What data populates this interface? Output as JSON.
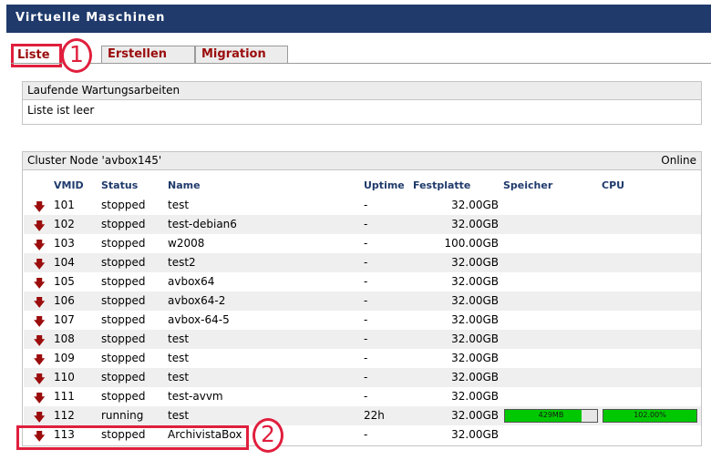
{
  "window_title": "Virtuelle Maschinen",
  "tabs": [
    {
      "label": "Liste",
      "active": true
    },
    {
      "label": "Erstellen",
      "active": false
    },
    {
      "label": "Migration",
      "active": false
    }
  ],
  "annotations": {
    "marker1": "1",
    "marker2": "2"
  },
  "maintenance": {
    "title": "Laufende Wartungsarbeiten",
    "body": "Liste ist leer"
  },
  "cluster": {
    "title": "Cluster Node 'avbox145'",
    "status": "Online",
    "columns": {
      "vmid": "VMID",
      "status": "Status",
      "name": "Name",
      "uptime": "Uptime",
      "disk": "Festplatte",
      "memory": "Speicher",
      "cpu": "CPU"
    },
    "rows": [
      {
        "vmid": "101",
        "status": "stopped",
        "name": "test",
        "uptime": "-",
        "disk": "32.00GB"
      },
      {
        "vmid": "102",
        "status": "stopped",
        "name": "test-debian6",
        "uptime": "-",
        "disk": "32.00GB"
      },
      {
        "vmid": "103",
        "status": "stopped",
        "name": "w2008",
        "uptime": "-",
        "disk": "100.00GB"
      },
      {
        "vmid": "104",
        "status": "stopped",
        "name": "test2",
        "uptime": "-",
        "disk": "32.00GB"
      },
      {
        "vmid": "105",
        "status": "stopped",
        "name": "avbox64",
        "uptime": "-",
        "disk": "32.00GB"
      },
      {
        "vmid": "106",
        "status": "stopped",
        "name": "avbox64-2",
        "uptime": "-",
        "disk": "32.00GB"
      },
      {
        "vmid": "107",
        "status": "stopped",
        "name": "avbox-64-5",
        "uptime": "-",
        "disk": "32.00GB"
      },
      {
        "vmid": "108",
        "status": "stopped",
        "name": "test",
        "uptime": "-",
        "disk": "32.00GB"
      },
      {
        "vmid": "109",
        "status": "stopped",
        "name": "test",
        "uptime": "-",
        "disk": "32.00GB"
      },
      {
        "vmid": "110",
        "status": "stopped",
        "name": "test",
        "uptime": "-",
        "disk": "32.00GB"
      },
      {
        "vmid": "111",
        "status": "stopped",
        "name": "test-avvm",
        "uptime": "-",
        "disk": "32.00GB"
      },
      {
        "vmid": "112",
        "status": "running",
        "name": "test",
        "uptime": "22h",
        "disk": "32.00GB",
        "memory": {
          "label": "429MB",
          "level_percent": 83
        },
        "cpu": {
          "label": "102.00%",
          "level_percent": 100
        }
      },
      {
        "vmid": "113",
        "status": "stopped",
        "name": "ArchivistaBox",
        "uptime": "-",
        "disk": "32.00GB"
      }
    ]
  },
  "icons": {
    "row_action": "red-down-arrow-icon"
  },
  "colors": {
    "title_bar": "#1f3a6b",
    "tab_text": "#9b0c0c",
    "highlight": "#e01f3d",
    "bar_fill": "#00c800"
  }
}
